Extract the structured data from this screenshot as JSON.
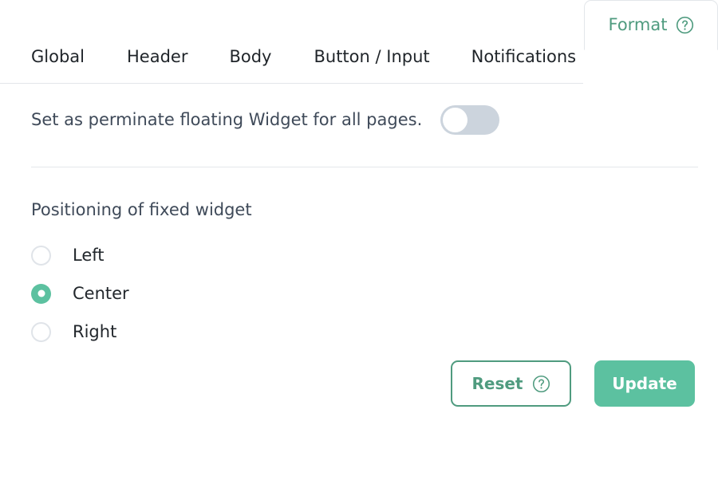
{
  "colors": {
    "accent_green": "#5cc1a0",
    "accent_green_dark": "#4f9b7f",
    "text_dark": "#22272c",
    "text_slate": "#3f4a59",
    "border_light": "#e3e6ea",
    "toggle_track_off": "#ccd4dd"
  },
  "tabs": [
    {
      "label": "Global",
      "active": false,
      "icon": null
    },
    {
      "label": "Header",
      "active": false,
      "icon": null
    },
    {
      "label": "Body",
      "active": false,
      "icon": null
    },
    {
      "label": "Button / Input",
      "active": false,
      "icon": null
    },
    {
      "label": "Notifications",
      "active": false,
      "icon": null
    },
    {
      "label": "Format",
      "active": true,
      "icon": "help-circle-icon"
    }
  ],
  "settings": {
    "floating_widget": {
      "label": "Set as perminate floating Widget for all pages.",
      "toggle_state": "off"
    },
    "positioning": {
      "label": "Positioning of fixed widget",
      "options": [
        {
          "label": "Left",
          "selected": false
        },
        {
          "label": "Center",
          "selected": true
        },
        {
          "label": "Right",
          "selected": false
        }
      ]
    }
  },
  "actions": {
    "reset": {
      "label": "Reset",
      "icon": "help-circle-icon"
    },
    "update": {
      "label": "Update"
    }
  }
}
